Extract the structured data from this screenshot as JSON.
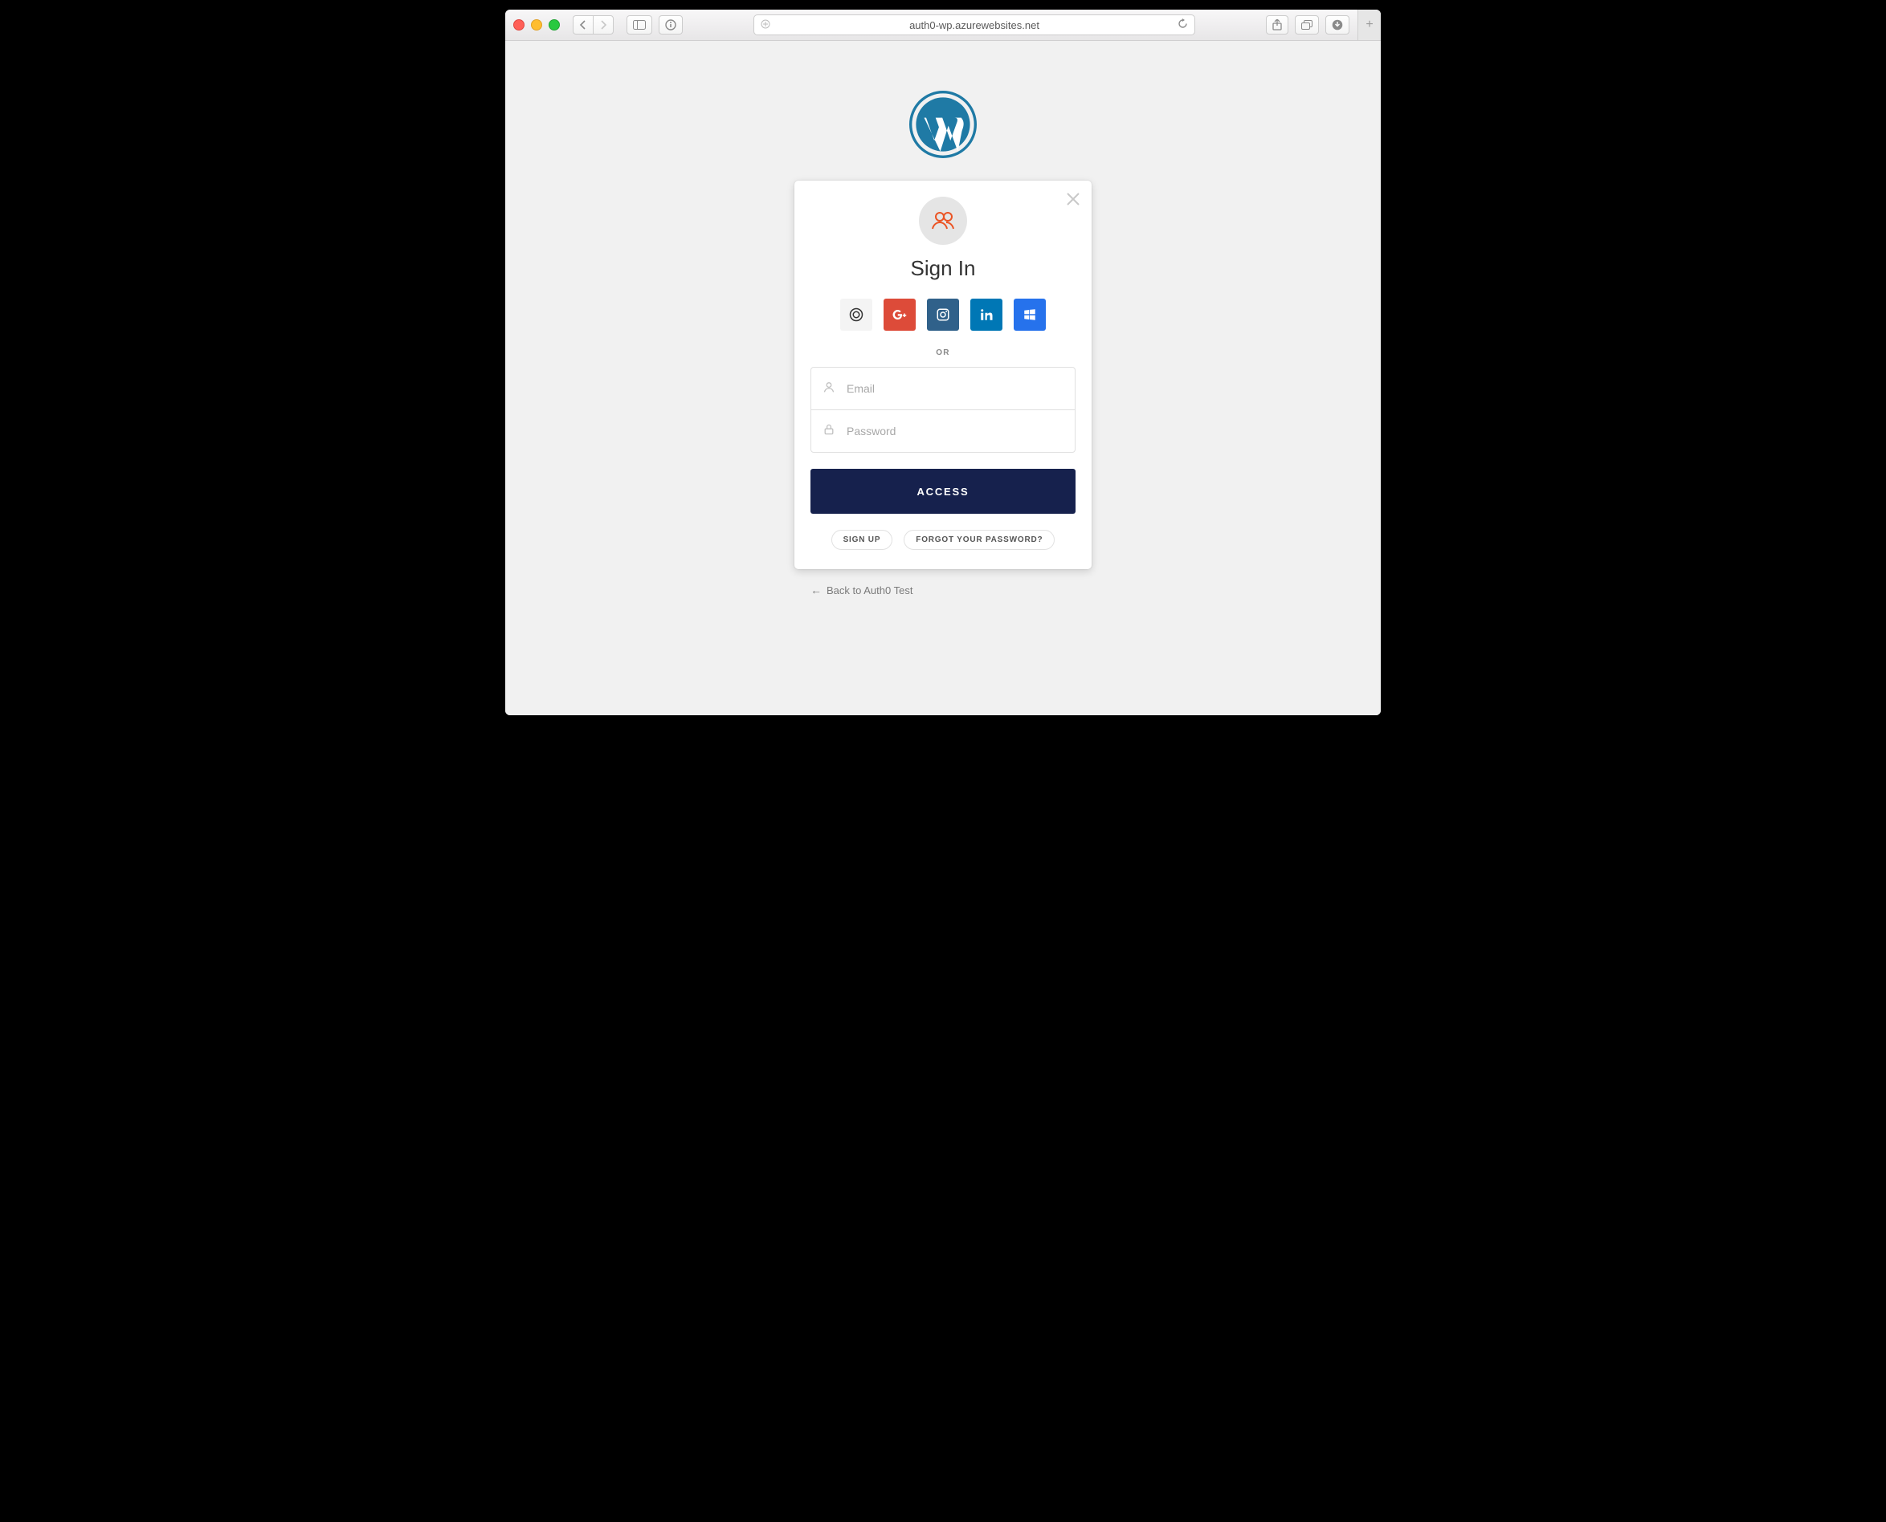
{
  "browser": {
    "url": "auth0-wp.azurewebsites.net"
  },
  "brand": {
    "wp_color": "#1f7aa5",
    "accent_deep_navy": "#16214d",
    "auth0_orange": "#eb5424"
  },
  "lock": {
    "title": "Sign In",
    "divider": "OR",
    "email_placeholder": "Email",
    "password_placeholder": "Password",
    "submit": "ACCESS",
    "signup": "SIGN UP",
    "forgot": "FORGOT YOUR PASSWORD?",
    "social": {
      "github": "github",
      "google": "google-plus",
      "instagram": "instagram",
      "linkedin": "linkedin",
      "windows": "windows"
    }
  },
  "footer": {
    "back": "Back to Auth0 Test"
  }
}
